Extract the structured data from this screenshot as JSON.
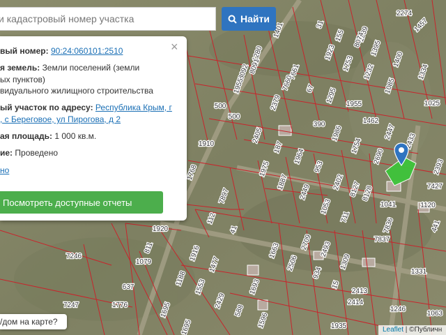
{
  "search": {
    "placeholder": "и кадастровый номер участка",
    "button_label": "Найти"
  },
  "popup": {
    "cad_label": "вый номер:",
    "cad_value": "90:24:060101:2510",
    "land_label": "я земель:",
    "land_value_1": "Земли поселений (земли",
    "land_value_2": "ых пунктов)",
    "land_value_3": "видуального жилищного строительства",
    "addr_label": "ый участок по адресу:",
    "addr_value_1": "Республика Крым, г",
    "addr_value_2": ", с Береговое, ул Пирогова, д 2",
    "area_label": "ая площадь:",
    "area_value": "1 000 кв.м.",
    "status_label": "ие:",
    "status_value": "Проведено",
    "more_link": "но",
    "report_button": "Посмотреть доступные отчеты",
    "close": "×"
  },
  "house_button": "/дом на карте?",
  "attribution": {
    "leaflet": "Leaflet",
    "sep": " | ©",
    "source": "Публичн"
  },
  "colors": {
    "primary": "#2f74c0",
    "success": "#4cae4c",
    "parcel_line": "#c8242b",
    "selected": "#3ec43a"
  },
  "parcels": [
    {
      "label": "1280"
    },
    {
      "label": "8091"
    },
    {
      "label": "8092"
    },
    {
      "label": "1955"
    },
    {
      "label": "7661"
    },
    {
      "label": "7660"
    },
    {
      "label": "67"
    },
    {
      "label": "1295"
    },
    {
      "label": "1955"
    },
    {
      "label": "2379"
    },
    {
      "label": "1910"
    },
    {
      "label": "500"
    },
    {
      "label": "500"
    },
    {
      "label": "1768"
    },
    {
      "label": "2405"
    },
    {
      "label": "1975"
    },
    {
      "label": "187"
    },
    {
      "label": "1964"
    },
    {
      "label": "390"
    },
    {
      "label": "1986"
    },
    {
      "label": "1462"
    },
    {
      "label": "1754"
    },
    {
      "label": "2447"
    },
    {
      "label": "2690"
    },
    {
      "label": "2433"
    },
    {
      "label": "1025"
    },
    {
      "label": "1887"
    },
    {
      "label": "953"
    },
    {
      "label": "2402"
    },
    {
      "label": "8127"
    },
    {
      "label": "8128"
    },
    {
      "label": "1041"
    },
    {
      "label": "2449"
    },
    {
      "label": "1053"
    },
    {
      "label": "711"
    },
    {
      "label": "7836"
    },
    {
      "label": "7837"
    },
    {
      "label": "7427"
    },
    {
      "label": "1120"
    },
    {
      "label": "441"
    },
    {
      "label": "7897"
    },
    {
      "label": "112"
    },
    {
      "label": "41"
    },
    {
      "label": "1920"
    },
    {
      "label": "811"
    },
    {
      "label": "1079"
    },
    {
      "label": "7246"
    },
    {
      "label": "637"
    },
    {
      "label": "1776"
    },
    {
      "label": "7247"
    },
    {
      "label": "1916"
    },
    {
      "label": "1477"
    },
    {
      "label": "1188"
    },
    {
      "label": "1553"
    },
    {
      "label": "2429"
    },
    {
      "label": "1663"
    },
    {
      "label": "2709"
    },
    {
      "label": "2506"
    },
    {
      "label": "2493"
    },
    {
      "label": "934"
    },
    {
      "label": "1309"
    },
    {
      "label": "15"
    },
    {
      "label": "2413"
    },
    {
      "label": "2414"
    },
    {
      "label": "1331"
    },
    {
      "label": "1246"
    },
    {
      "label": "1693"
    },
    {
      "label": "588"
    },
    {
      "label": "1596"
    },
    {
      "label": "1695"
    },
    {
      "label": "1695"
    },
    {
      "label": "1935"
    },
    {
      "label": "1401"
    },
    {
      "label": "31"
    },
    {
      "label": "1989"
    },
    {
      "label": "2274"
    },
    {
      "label": "1457"
    },
    {
      "label": "1923"
    },
    {
      "label": "1753"
    },
    {
      "label": "1232"
    },
    {
      "label": "1400"
    },
    {
      "label": "1334"
    },
    {
      "label": "1085"
    },
    {
      "label": "1395"
    },
    {
      "label": "8074"
    },
    {
      "label": "155"
    },
    {
      "label": "2393"
    },
    {
      "label": "1063"
    }
  ]
}
